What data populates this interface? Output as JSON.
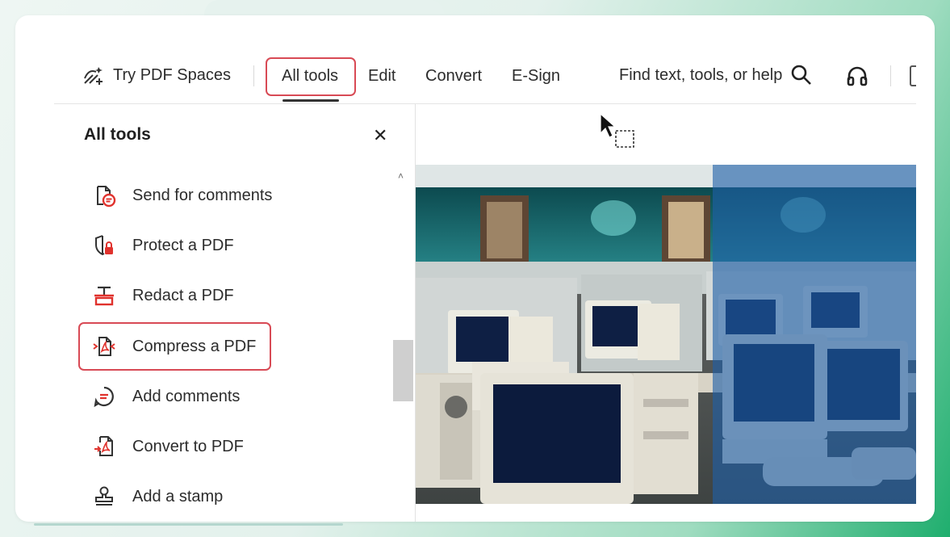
{
  "toolbar": {
    "try_pdf_spaces": "Try PDF Spaces",
    "tabs": [
      {
        "label": "All tools"
      },
      {
        "label": "Edit"
      },
      {
        "label": "Convert"
      },
      {
        "label": "E-Sign"
      }
    ],
    "search_label": "Find text, tools, or help"
  },
  "panel": {
    "title": "All tools",
    "items": [
      {
        "label": "Send for comments",
        "icon": "send-for-comments-icon"
      },
      {
        "label": "Protect a PDF",
        "icon": "protect-shield-lock-icon"
      },
      {
        "label": "Redact a PDF",
        "icon": "redact-icon"
      },
      {
        "label": "Compress a PDF",
        "icon": "compress-pdf-icon"
      },
      {
        "label": "Add comments",
        "icon": "comment-icon"
      },
      {
        "label": "Convert to PDF",
        "icon": "convert-to-pdf-icon"
      },
      {
        "label": "Add a stamp",
        "icon": "stamp-icon"
      }
    ]
  },
  "colors": {
    "accent_red": "#d84a55",
    "icon_red": "#e0322d",
    "overlay_blue": "#1f5fa8"
  }
}
